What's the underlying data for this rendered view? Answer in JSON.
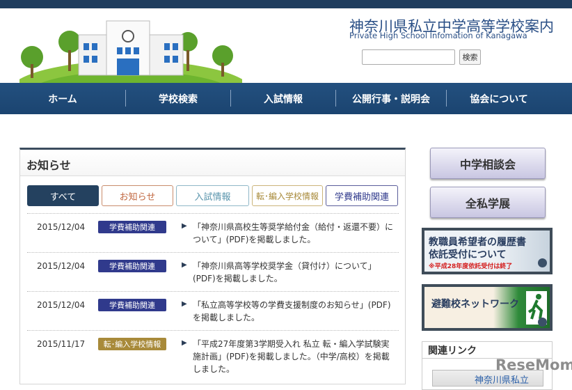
{
  "header": {
    "title": "神奈川県私立中学高等学校案内",
    "subtitle": "Private High School Infomation of Kanagawa",
    "search_placeholder": "",
    "search_button": "検索"
  },
  "nav": [
    "ホーム",
    "学校検索",
    "入試情報",
    "公開行事・説明会",
    "協会について"
  ],
  "news": {
    "title": "お知らせ",
    "tabs": [
      {
        "label": "すべて",
        "active": true
      },
      {
        "label": "お知らせ"
      },
      {
        "label": "入試情報"
      },
      {
        "label": "転･編入学校情報"
      },
      {
        "label": "学費補助関連"
      }
    ],
    "items": [
      {
        "date": "2015/12/04",
        "category": "学費補助関連",
        "text": "「神奈川県高校生等奨学給付金（給付・返還不要）について」(PDF)を掲載しました。"
      },
      {
        "date": "2015/12/04",
        "category": "学費補助関連",
        "text": "「神奈川県高等学校奨学金（貸付け）について」(PDF)を掲載しました。"
      },
      {
        "date": "2015/12/04",
        "category": "学費補助関連",
        "text": "「私立高等学校等の学費支援制度のお知らせ」(PDF)を掲載しました。"
      },
      {
        "date": "2015/11/17",
        "category": "転･編入学校情報",
        "text": "「平成27年度第3学期受入れ 私立 転・編入学試験実施計画」(PDF)を掲載しました。（中学/高校）を掲載しました。"
      }
    ]
  },
  "sidebar": {
    "buttons": [
      "中学相談会",
      "全私学展"
    ],
    "banner1": {
      "line1": "教職員希望者の履歴書",
      "line2": "依託受付について",
      "note": "※平成28年度依託受付は終了"
    },
    "banner2": {
      "label": "避難校ネットワーク"
    },
    "links_title": "関連リンク",
    "links_item": "神奈川県私立"
  },
  "watermark": "ReseMom",
  "colors": {
    "nav": "#1f4b7a",
    "badge_fee": "#303a8c",
    "badge_transfer": "#a88a3a",
    "tab_active": "#24415f"
  }
}
